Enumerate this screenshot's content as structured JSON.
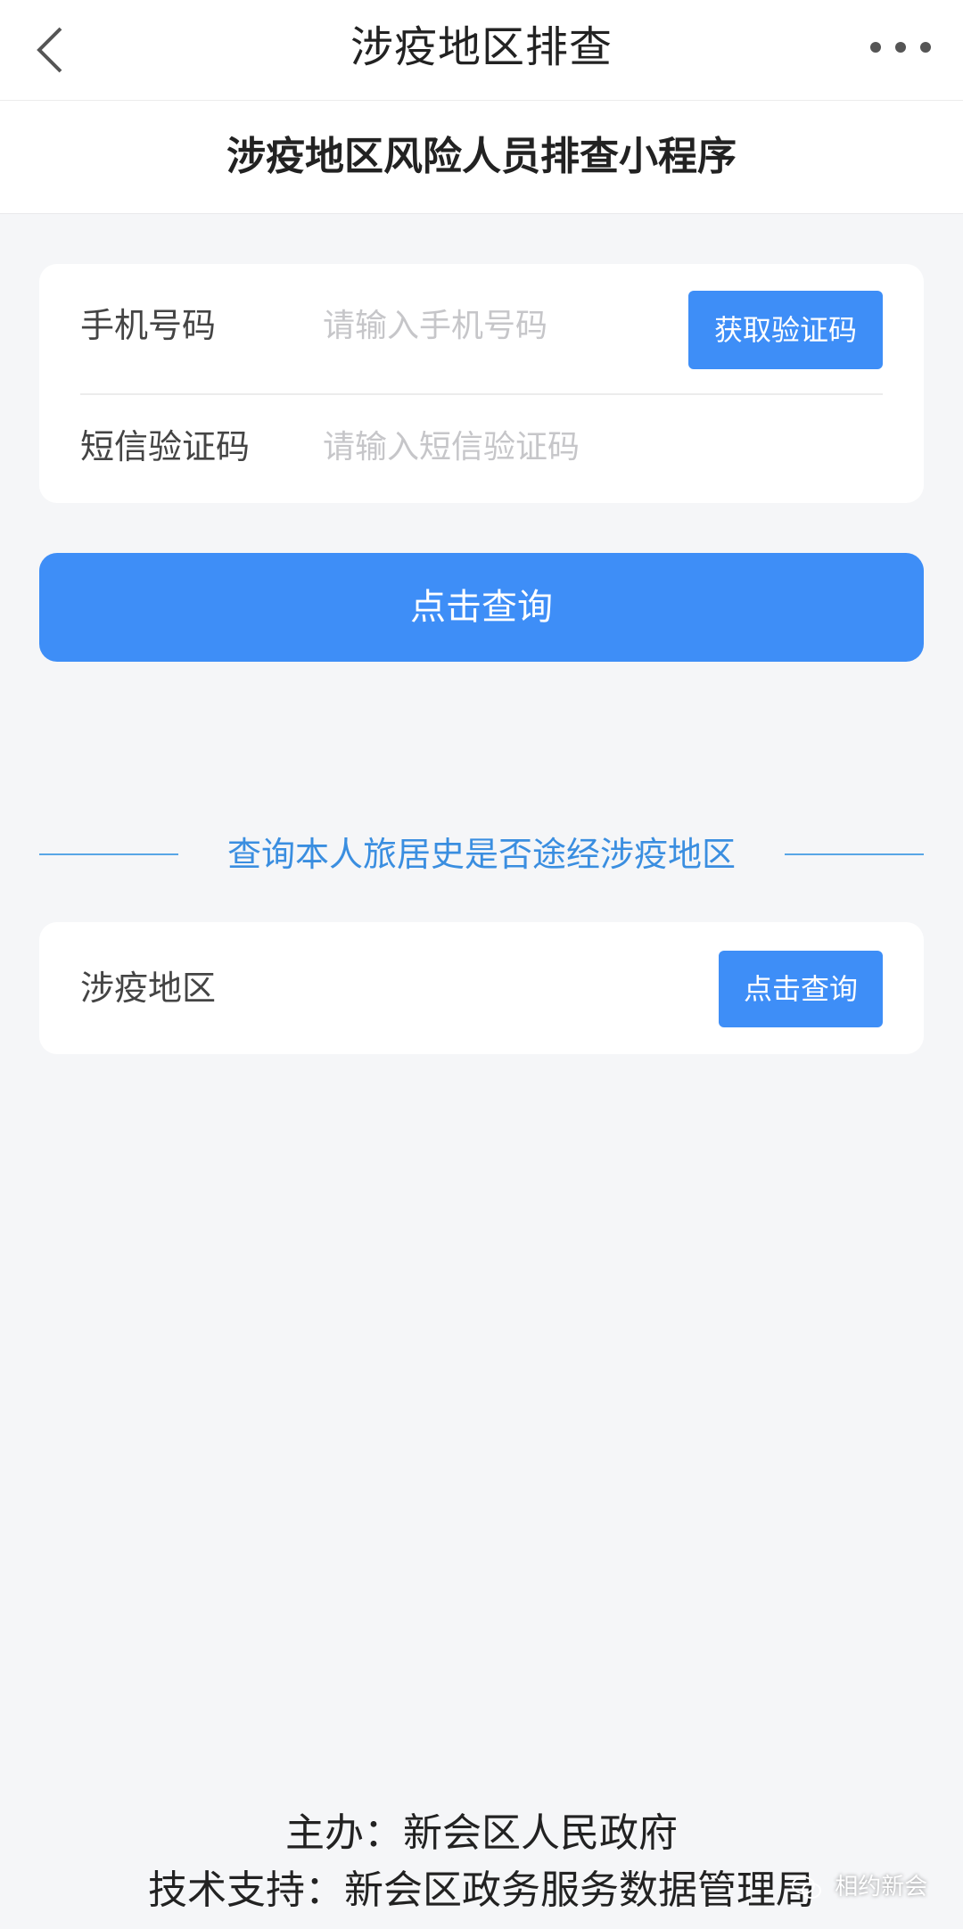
{
  "navbar": {
    "title": "涉疫地区排查",
    "back_icon": "chevron-left-icon",
    "more_icon": "more-dots-icon"
  },
  "subheader": {
    "title": "涉疫地区风险人员排查小程序"
  },
  "login_form": {
    "phone_label": "手机号码",
    "phone_placeholder": "请输入手机号码",
    "phone_value": "",
    "get_code_button": "获取验证码",
    "sms_label": "短信验证码",
    "sms_placeholder": "请输入短信验证码",
    "sms_value": ""
  },
  "query_button": "点击查询",
  "section": {
    "title": "查询本人旅居史是否途经涉疫地区"
  },
  "area_card": {
    "label": "涉疫地区",
    "button": "点击查询"
  },
  "footer": {
    "organizer": "主办：新会区人民政府",
    "support": "技术支持：新会区政务服务数据管理局"
  },
  "watermark": {
    "text": "相约新会",
    "icon": "wechat-icon"
  },
  "colors": {
    "accent": "#3e8ef7",
    "section_text": "#3a8ee0",
    "background": "#f5f6f8"
  }
}
